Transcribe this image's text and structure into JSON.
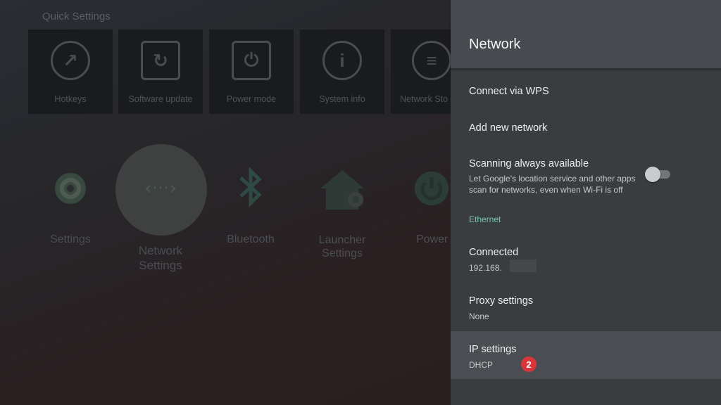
{
  "quick_settings": {
    "title": "Quick Settings",
    "tiles": [
      {
        "label": "Hotkeys",
        "icon": "hotkeys-icon"
      },
      {
        "label": "Software update",
        "icon": "software-update-icon"
      },
      {
        "label": "Power mode",
        "icon": "power-mode-icon"
      },
      {
        "label": "System info",
        "icon": "info-icon"
      },
      {
        "label": "Network Sto",
        "icon": "network-storage-icon"
      }
    ]
  },
  "apps": [
    {
      "label": "Settings",
      "icon": "settings-icon"
    },
    {
      "label": "Network Settings",
      "icon": "network-settings-icon"
    },
    {
      "label": "Bluetooth",
      "icon": "bluetooth-icon"
    },
    {
      "label": "Launcher Settings",
      "icon": "launcher-settings-icon"
    },
    {
      "label": "Power",
      "icon": "power-icon"
    }
  ],
  "panel": {
    "title": "Network",
    "connect_wps": "Connect via WPS",
    "add_network": "Add new network",
    "scanning": {
      "title": "Scanning always available",
      "subtitle": "Let Google's location service and other apps scan for networks, even when Wi-Fi is off",
      "enabled": false
    },
    "section_ethernet": "Ethernet",
    "connected": {
      "title": "Connected",
      "ip": "192.168."
    },
    "proxy": {
      "title": "Proxy settings",
      "value": "None"
    },
    "ip_settings": {
      "title": "IP settings",
      "value": "DHCP"
    },
    "badge": "2"
  },
  "colors": {
    "accent": "#74c8a8",
    "badge": "#d9363b",
    "selected_row": "#4a4e52"
  }
}
